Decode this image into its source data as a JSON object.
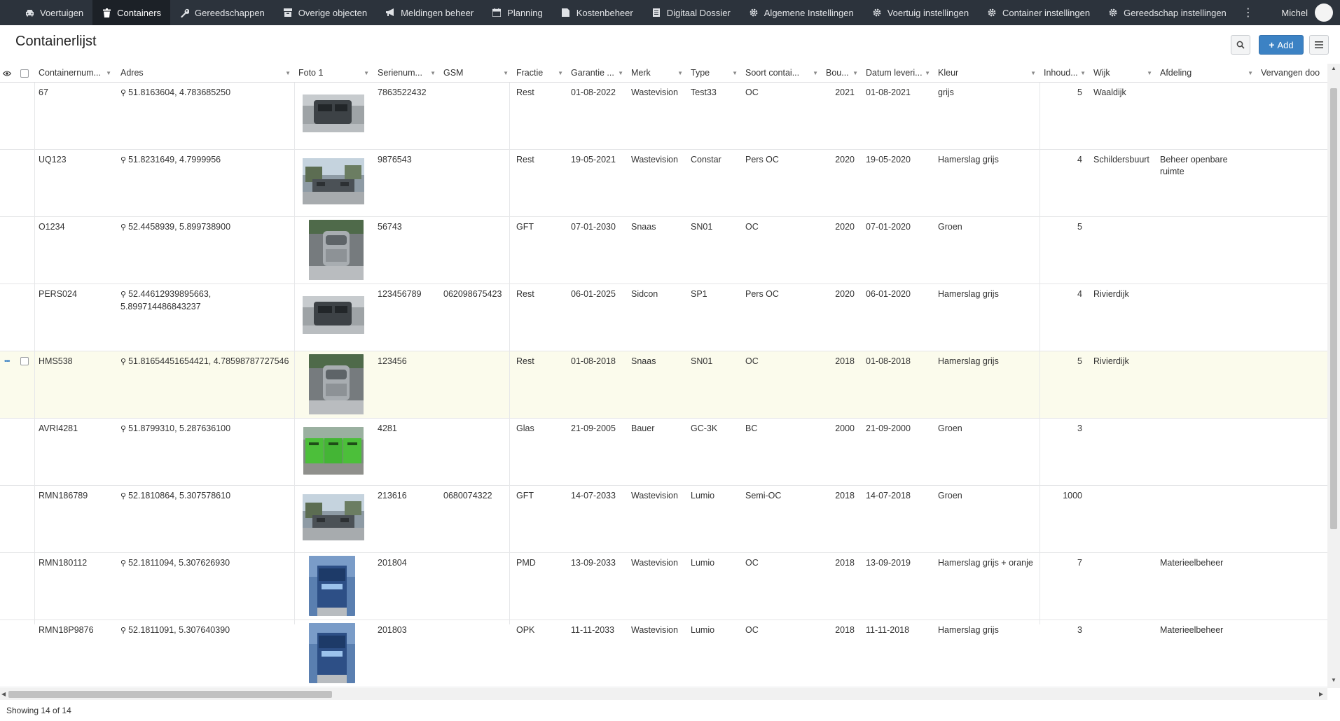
{
  "nav": {
    "items": [
      {
        "label": "Voertuigen",
        "icon": "car-icon"
      },
      {
        "label": "Containers",
        "icon": "trash-icon",
        "active": true
      },
      {
        "label": "Gereedschappen",
        "icon": "wrench-icon"
      },
      {
        "label": "Overige objecten",
        "icon": "box-icon"
      },
      {
        "label": "Meldingen beheer",
        "icon": "megaphone-icon"
      },
      {
        "label": "Planning",
        "icon": "calendar-icon"
      },
      {
        "label": "Kostenbeheer",
        "icon": "folder-icon"
      },
      {
        "label": "Digitaal Dossier",
        "icon": "document-icon"
      },
      {
        "label": "Algemene Instellingen",
        "icon": "gear-icon"
      },
      {
        "label": "Voertuig instellingen",
        "icon": "gear-icon"
      },
      {
        "label": "Container instellingen",
        "icon": "gear-icon"
      },
      {
        "label": "Gereedschap instellingen",
        "icon": "gear-icon"
      }
    ],
    "user": "Michel"
  },
  "page": {
    "title": "Containerlijst",
    "add_label": "Add"
  },
  "columns": [
    "Containernum...",
    "Adres",
    "Foto 1",
    "Serienum...",
    "GSM",
    "Fractie",
    "Garantie ...",
    "Merk",
    "Type",
    "Soort contai...",
    "Bou...",
    "Datum leveri...",
    "Kleur",
    "Inhoud...",
    "Wijk",
    "Afdeling",
    "Vervangen doo"
  ],
  "rows": [
    {
      "nr": "67",
      "adres": "51.8163604, 4.783685250",
      "serie": "7863522432",
      "gsm": "",
      "fractie": "Rest",
      "garantie": "01-08-2022",
      "merk": "Wastevision",
      "type": "Test33",
      "soort": "OC",
      "bouwjaar": "2021",
      "levering": "01-08-2021",
      "kleur": "grijs",
      "inhoud": "5",
      "wijk": "Waaldijk",
      "afdeling": "",
      "photo": "dark"
    },
    {
      "nr": "UQ123",
      "adres": "51.8231649, 4.7999956",
      "serie": "9876543",
      "gsm": "",
      "fractie": "Rest",
      "garantie": "19-05-2021",
      "merk": "Wastevision",
      "type": "Constar",
      "soort": "Pers OC",
      "bouwjaar": "2020",
      "levering": "19-05-2020",
      "kleur": "Hamerslag grijs",
      "inhoud": "4",
      "wijk": "Schildersbuurt",
      "afdeling": "Beheer openbare ruimte",
      "photo": "street"
    },
    {
      "nr": "O1234",
      "adres": "52.4458939, 5.899738900",
      "serie": "56743",
      "gsm": "",
      "fractie": "GFT",
      "garantie": "07-01-2030",
      "merk": "Snaas",
      "type": "SN01",
      "soort": "OC",
      "bouwjaar": "2020",
      "levering": "07-01-2020",
      "kleur": "Groen",
      "inhoud": "5",
      "wijk": "",
      "afdeling": "",
      "photo": "metal"
    },
    {
      "nr": "PERS024",
      "adres": "52.44612939895663, 5.899714486843237",
      "serie": "123456789",
      "gsm": "062098675423",
      "fractie": "Rest",
      "garantie": "06-01-2025",
      "merk": "Sidcon",
      "type": "SP1",
      "soort": "Pers OC",
      "bouwjaar": "2020",
      "levering": "06-01-2020",
      "kleur": "Hamerslag grijs",
      "inhoud": "4",
      "wijk": "Rivierdijk",
      "afdeling": "",
      "photo": "dark"
    },
    {
      "nr": "HMS538",
      "adres": "51.81654451654421, 4.78598787727546",
      "serie": "123456",
      "gsm": "",
      "fractie": "Rest",
      "garantie": "01-08-2018",
      "merk": "Snaas",
      "type": "SN01",
      "soort": "OC",
      "bouwjaar": "2018",
      "levering": "01-08-2018",
      "kleur": "Hamerslag grijs",
      "inhoud": "5",
      "wijk": "Rivierdijk",
      "afdeling": "",
      "photo": "metal",
      "highlight": true
    },
    {
      "nr": "AVRI4281",
      "adres": "51.8799310, 5.287636100",
      "serie": "4281",
      "gsm": "",
      "fractie": "Glas",
      "garantie": "21-09-2005",
      "merk": "Bauer",
      "type": "GC-3K",
      "soort": "BC",
      "bouwjaar": "2000",
      "levering": "21-09-2000",
      "kleur": "Groen",
      "inhoud": "3",
      "wijk": "",
      "afdeling": "",
      "photo": "green"
    },
    {
      "nr": "RMN186789",
      "adres": "52.1810864, 5.307578610",
      "serie": "213616",
      "gsm": "0680074322",
      "fractie": "GFT",
      "garantie": "14-07-2033",
      "merk": "Wastevision",
      "type": "Lumio",
      "soort": "Semi-OC",
      "bouwjaar": "2018",
      "levering": "14-07-2018",
      "kleur": "Groen",
      "inhoud": "1000",
      "wijk": "",
      "afdeling": "",
      "photo": "street"
    },
    {
      "nr": "RMN180112",
      "adres": "52.1811094, 5.307626930",
      "serie": "201804",
      "gsm": "",
      "fractie": "PMD",
      "garantie": "13-09-2033",
      "merk": "Wastevision",
      "type": "Lumio",
      "soort": "OC",
      "bouwjaar": "2018",
      "levering": "13-09-2019",
      "kleur": "Hamerslag grijs + oranje",
      "inhoud": "7",
      "wijk": "",
      "afdeling": "Materieelbeheer",
      "photo": "blue"
    },
    {
      "nr": "RMN18P9876",
      "adres": "52.1811091, 5.307640390",
      "serie": "201803",
      "gsm": "",
      "fractie": "OPK",
      "garantie": "11-11-2033",
      "merk": "Wastevision",
      "type": "Lumio",
      "soort": "OC",
      "bouwjaar": "2018",
      "levering": "11-11-2018",
      "kleur": "Hamerslag grijs",
      "inhoud": "3",
      "wijk": "",
      "afdeling": "Materieelbeheer",
      "photo": "blue"
    }
  ],
  "footer": {
    "text": "Showing 14 of 14"
  },
  "colors": {
    "nav_bg": "#2c333c",
    "accent": "#3c82c4",
    "highlight_row": "#fbfbec"
  }
}
